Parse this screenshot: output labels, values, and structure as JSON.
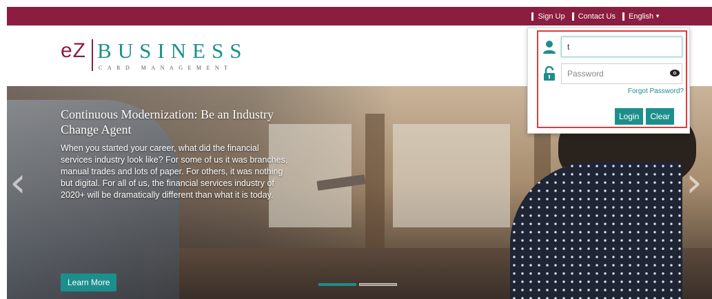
{
  "topbar": {
    "links": [
      "Sign Up",
      "Contact Us",
      "English"
    ],
    "background": "#8b1d41"
  },
  "logo": {
    "ez": "eZ",
    "business": "BUSINESS",
    "subtitle": "CARD MANAGEMENT"
  },
  "hero": {
    "title": "Continuous Modernization: Be an Industry Change Agent",
    "body": "When you started your career, what did the financial services industry look like? For some of us it was branches, manual trades and lots of paper. For others, it was nothing but digital. For all of us, the financial services industry of 2020+ will be dramatically different than what it is today.",
    "cta_label": "Learn More",
    "slides_total": 2,
    "active_slide": 1
  },
  "login": {
    "username_value": "t",
    "password_placeholder": "Password",
    "forgot_label": "Forgot Password?",
    "login_label": "Login",
    "clear_label": "Clear",
    "icons": [
      "user-icon",
      "unlock-icon",
      "eye-icon"
    ]
  },
  "colors": {
    "brand": "#8b1d41",
    "accent": "#1c8f8c",
    "highlight": "#e03a3a"
  }
}
